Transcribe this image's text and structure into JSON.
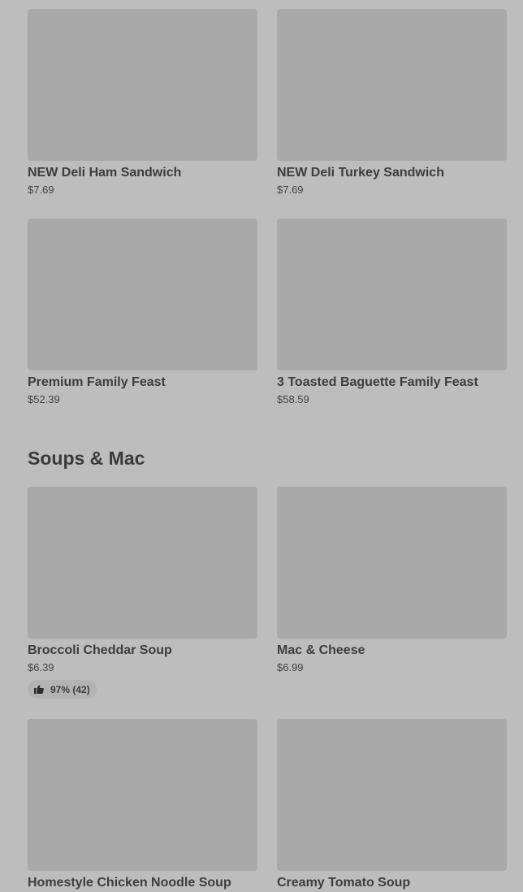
{
  "top_items": [
    {
      "name": "NEW Deli Ham Sandwich",
      "price": "$7.69"
    },
    {
      "name": "NEW Deli Turkey Sandwich",
      "price": "$7.69"
    },
    {
      "name": "Premium Family Feast",
      "price": "$52.39"
    },
    {
      "name": "3 Toasted Baguette Family Feast",
      "price": "$58.59"
    }
  ],
  "soups_section": {
    "title": "Soups & Mac",
    "items": [
      {
        "name": "Broccoli Cheddar Soup",
        "price": "$6.39",
        "rating": "97% (42)",
        "rating_icon": "thumbs-up-icon"
      },
      {
        "name": "Mac & Cheese",
        "price": "$6.99"
      },
      {
        "name": "Homestyle Chicken Noodle Soup"
      },
      {
        "name": "Creamy Tomato Soup"
      }
    ]
  }
}
